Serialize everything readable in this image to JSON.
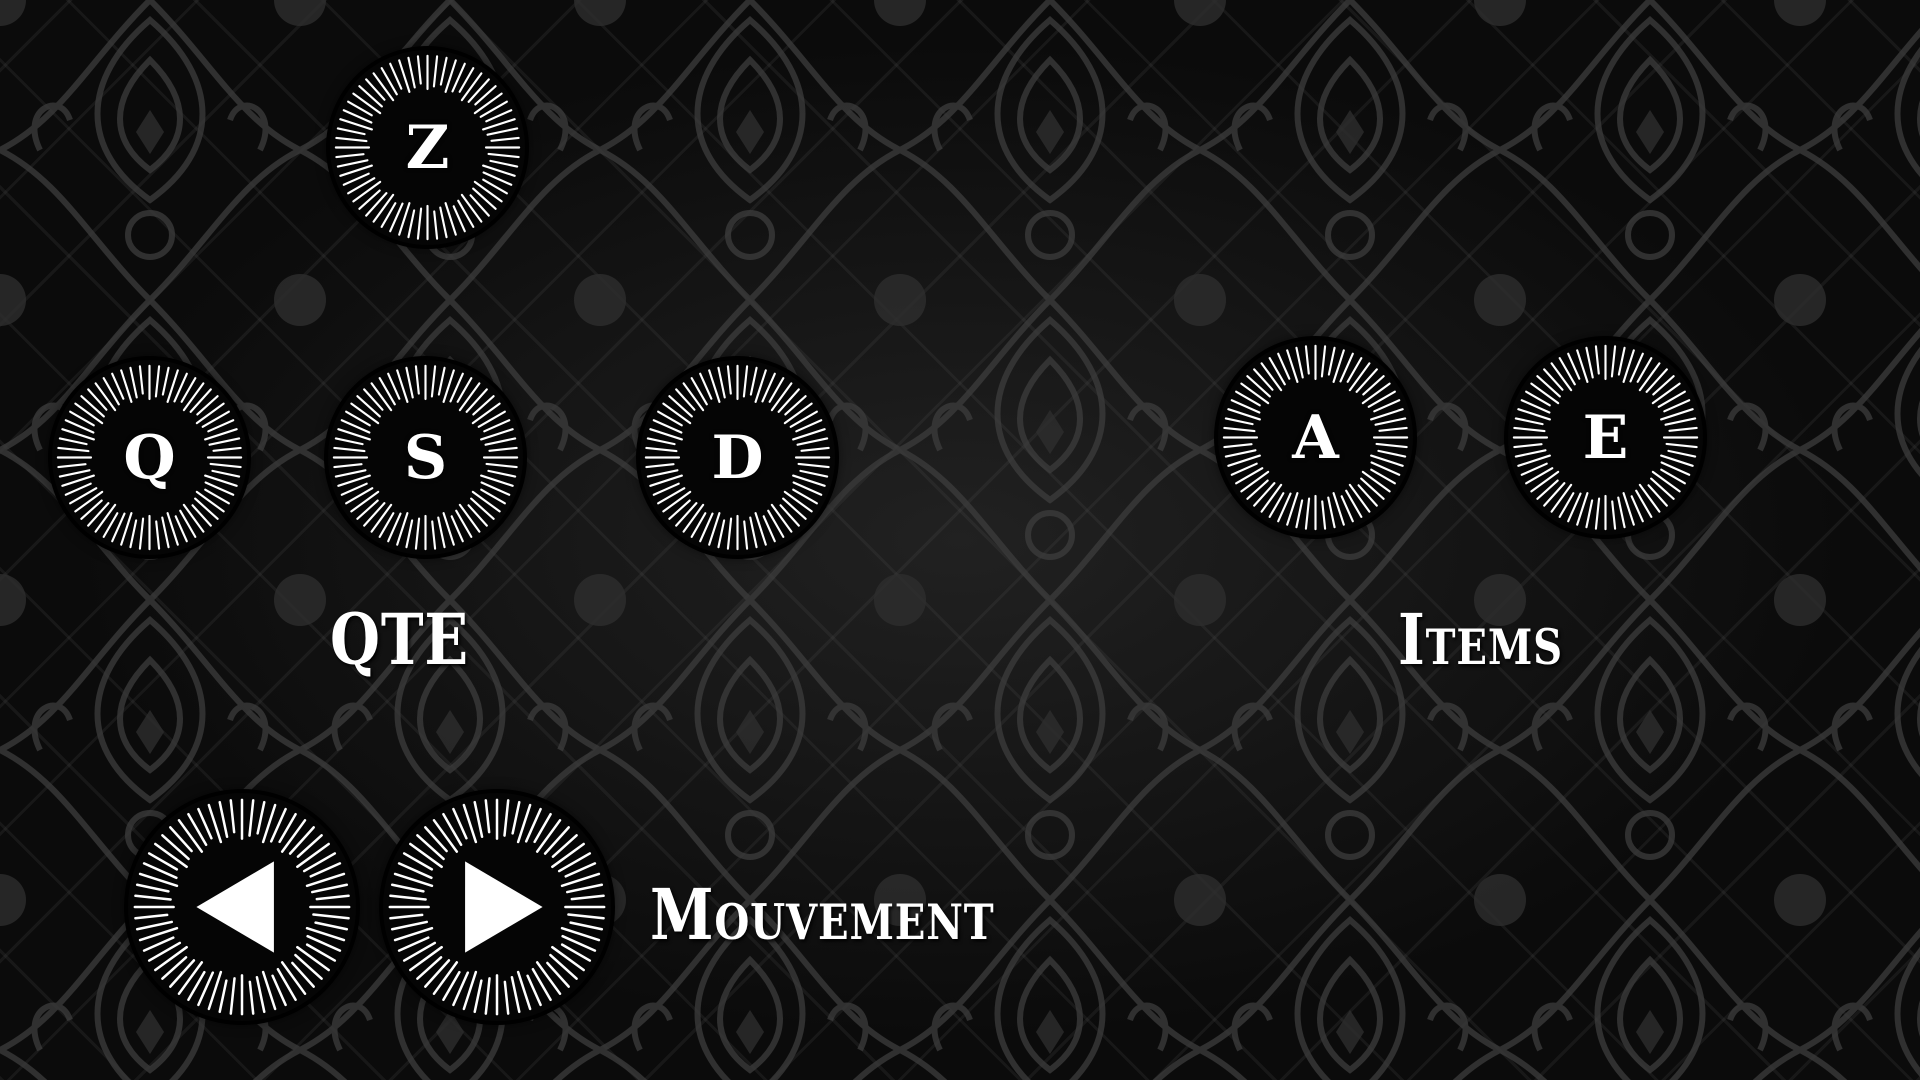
{
  "keys": {
    "z": "Z",
    "q": "Q",
    "s": "S",
    "d": "D",
    "a": "A",
    "e": "E"
  },
  "labels": {
    "qte": "QTE",
    "items": "Items",
    "movement": "Mouvement"
  },
  "arrows": {
    "left": "left-arrow-icon",
    "right": "right-arrow-icon"
  },
  "colors": {
    "background": "#0b0b0b",
    "pattern": "#3a3a3a",
    "key_fill": "#050505",
    "text": "#ffffff"
  }
}
